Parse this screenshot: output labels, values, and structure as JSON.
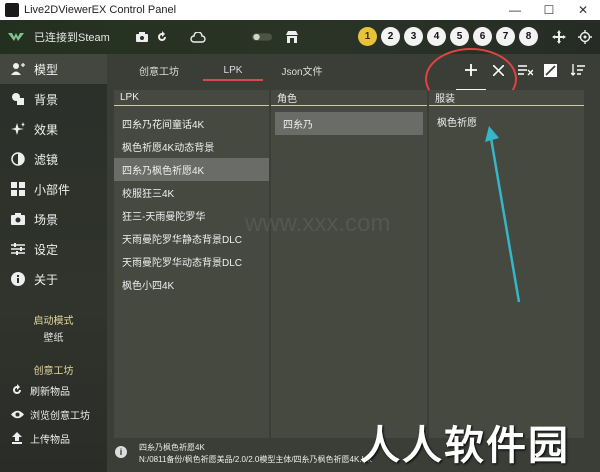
{
  "window": {
    "title": "Live2DViewerEX Control Panel",
    "minimize_glyph": "—",
    "maximize_glyph": "☐",
    "close_glyph": "✕"
  },
  "topbar": {
    "steam_status": "已连接到Steam",
    "numbers": [
      "1",
      "2",
      "3",
      "4",
      "5",
      "6",
      "7",
      "8"
    ],
    "active_number_index": 0
  },
  "sidebar": {
    "items": [
      {
        "label": "模型",
        "icon": "person-icon",
        "selected": true
      },
      {
        "label": "背景",
        "icon": "image-icon",
        "selected": false
      },
      {
        "label": "效果",
        "icon": "sparkle-icon",
        "selected": false
      },
      {
        "label": "滤镜",
        "icon": "filter-icon",
        "selected": false
      },
      {
        "label": "小部件",
        "icon": "widgets-icon",
        "selected": false
      },
      {
        "label": "场景",
        "icon": "camera-icon",
        "selected": false
      },
      {
        "label": "设定",
        "icon": "sliders-icon",
        "selected": false
      },
      {
        "label": "关于",
        "icon": "info-icon",
        "selected": false
      }
    ],
    "launch_mode_label": "启动模式",
    "launch_mode_value": "壁纸",
    "workshop_section": "创意工坊",
    "workshop_actions": [
      {
        "label": "刷新物品",
        "icon": "refresh-icon"
      },
      {
        "label": "浏览创意工坊",
        "icon": "eye-icon"
      },
      {
        "label": "上传物品",
        "icon": "upload-icon"
      }
    ]
  },
  "tabs": [
    {
      "label": "创意工坊",
      "active": false
    },
    {
      "label": "LPK",
      "active": true
    },
    {
      "label": "Json文件",
      "active": false
    }
  ],
  "toolbar": {
    "add_tooltip": "添加"
  },
  "lpk_panel": {
    "header": "LPK",
    "items": [
      {
        "label": "四糸乃花间童话4K",
        "selected": false
      },
      {
        "label": "枫色祈愿4K动态背景",
        "selected": false
      },
      {
        "label": "四糸乃枫色祈愿4K",
        "selected": true
      },
      {
        "label": "校服狂三4K",
        "selected": false
      },
      {
        "label": "狂三-天雨曼陀罗华",
        "selected": false
      },
      {
        "label": "天雨曼陀罗华静态背景DLC",
        "selected": false
      },
      {
        "label": "天雨曼陀罗华动态背景DLC",
        "selected": false
      },
      {
        "label": "枫色小四4K",
        "selected": false
      }
    ]
  },
  "role_panel": {
    "header": "角色",
    "items": [
      {
        "label": "四糸乃",
        "selected": true
      }
    ]
  },
  "costume_panel": {
    "header": "服装",
    "items": [
      {
        "label": "枫色祈愿",
        "selected": false
      }
    ]
  },
  "statusbar": {
    "line1": "四糸乃枫色祈愿4K",
    "line2": "N:/0811备份/枫色祈愿美品/2.0/2.0模型主体/四糸乃枫色祈愿4K.lpk"
  },
  "watermark": {
    "text": "人人软件园",
    "faint_text": "www.xxx.com"
  },
  "colors": {
    "accent_tab_underline": "#d54b4b",
    "annotation_red": "#e34242",
    "annotation_arrow": "#36b6c8",
    "active_number": "#e8c23a"
  }
}
